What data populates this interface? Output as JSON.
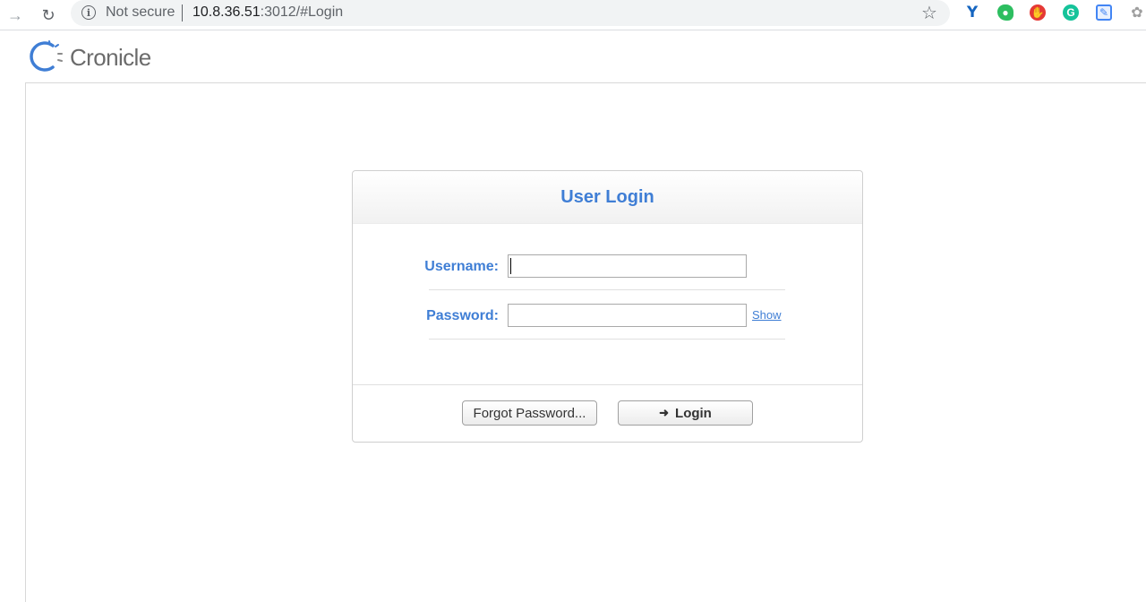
{
  "browser": {
    "security_label": "Not secure",
    "url_host": "10.8.36.51",
    "url_rest": ":3012/#Login",
    "extensions": [
      "ext-y-icon",
      "evernote-icon",
      "stop-icon",
      "grammarly-icon",
      "pen-icon",
      "paw-icon"
    ]
  },
  "app": {
    "name": "Cronicle",
    "brand_color": "#3f7ed5"
  },
  "login": {
    "title": "User Login",
    "username_label": "Username:",
    "username_value": "",
    "password_label": "Password:",
    "password_value": "",
    "show_link": "Show",
    "forgot_button": "Forgot Password...",
    "login_button": "Login"
  }
}
